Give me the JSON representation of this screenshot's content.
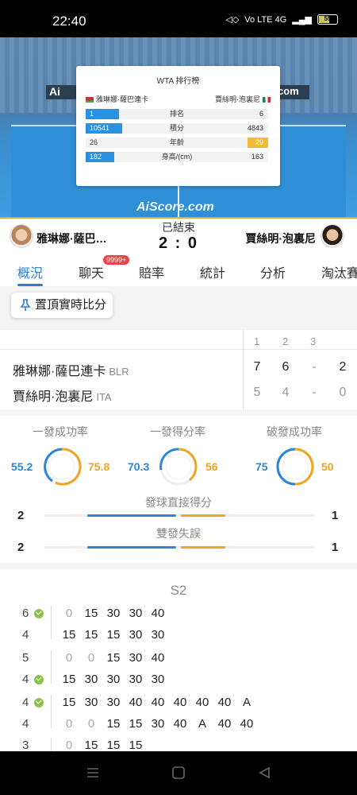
{
  "status_bar": {
    "time": "22:40",
    "battery": "55",
    "net_labels": "Vo LTE 4G"
  },
  "video": {
    "banner_left": "Ai",
    "banner_right": "com",
    "watermark": "AiScore.com"
  },
  "ranking_card": {
    "title": "WTA 排行榜",
    "player1": "雅琳娜·薩巴連卡",
    "player2": "賈絲明·泡裏尼",
    "rows": [
      {
        "label": "排名",
        "p1": "1",
        "p2": "6"
      },
      {
        "label": "積分",
        "p1": "10541",
        "p2": "4843"
      },
      {
        "label": "年齡",
        "p1": "26",
        "p2": "29"
      },
      {
        "label": "身高/(cm)",
        "p1": "182",
        "p2": "163"
      }
    ]
  },
  "match": {
    "status": "已結束",
    "score": "2 : 0",
    "player1_short": "雅琳娜·薩巴…",
    "player2_short": "賈絲明·泡裏尼"
  },
  "tabs": {
    "items": [
      "概況",
      "聊天",
      "賠率",
      "統計",
      "分析",
      "淘汰賽"
    ],
    "chat_badge": "9999+"
  },
  "pin_button": "置頂實時比分",
  "sets": {
    "headers": [
      "1",
      "2",
      "3"
    ],
    "players": [
      {
        "name": "雅琳娜·薩巴連卡",
        "country": "BLR",
        "s1": "7",
        "s2": "6",
        "s3": "-",
        "total": "2"
      },
      {
        "name": "賈絲明·泡裏尼",
        "country": "ITA",
        "s1": "5",
        "s2": "4",
        "s3": "-",
        "total": "0"
      }
    ]
  },
  "stats": {
    "rings": [
      {
        "title": "一發成功率",
        "p1": "55.2",
        "p2": "75.8"
      },
      {
        "title": "一發得分率",
        "p1": "70.3",
        "p2": "56"
      },
      {
        "title": "破發成功率",
        "p1": "75",
        "p2": "50"
      }
    ],
    "bars": [
      {
        "label": "發球直接得分",
        "p1": "2",
        "p2": "1"
      },
      {
        "label": "雙發失誤",
        "p1": "2",
        "p2": "1"
      }
    ]
  },
  "points": {
    "set_label": "S2",
    "games": [
      {
        "top": "6",
        "bottom": "4",
        "winner": "top",
        "top_pts": [
          "0",
          "15",
          "30",
          "30",
          "40"
        ],
        "bottom_pts": [
          "15",
          "15",
          "15",
          "30",
          "30"
        ]
      },
      {
        "top": "5",
        "bottom": "4",
        "winner": "bottom",
        "top_pts": [
          "0",
          "0",
          "15",
          "30",
          "40"
        ],
        "bottom_pts": [
          "15",
          "30",
          "30",
          "30",
          "30"
        ]
      },
      {
        "top": "4",
        "bottom": "4",
        "winner": "top",
        "top_pts": [
          "15",
          "30",
          "30",
          "40",
          "40",
          "40",
          "40",
          "40",
          "A"
        ],
        "bottom_pts": [
          "0",
          "0",
          "15",
          "15",
          "30",
          "40",
          "A",
          "40",
          "40"
        ]
      },
      {
        "top": "3",
        "bottom": "",
        "winner": "",
        "top_pts": [
          "0",
          "15",
          "15",
          "15"
        ],
        "bottom_pts": []
      }
    ]
  },
  "colors": {
    "accent_blue": "#2a86d8",
    "accent_orange": "#f0a520",
    "badge_red": "#e8444a"
  }
}
